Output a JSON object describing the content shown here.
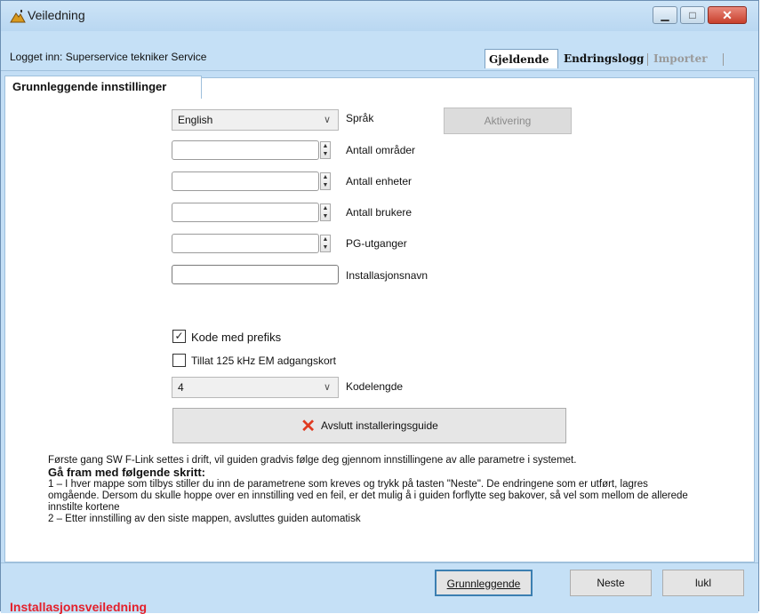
{
  "window": {
    "title": "Veiledning"
  },
  "header": {
    "logged_in": "Logget inn: Superservice tekniker Service",
    "tabs": [
      "Gjeldende",
      "Endringslogg",
      "Importer"
    ]
  },
  "subtab": "Grunnleggende innstillinger",
  "form": {
    "language": {
      "value": "English",
      "label": "Språk"
    },
    "activate_label": "Aktivering",
    "areas_label": "Antall områder",
    "units_label": "Antall enheter",
    "users_label": "Antall brukere",
    "pg_label": "PG-utganger",
    "install_name_label": "Installasjonsnavn",
    "prefix": {
      "label": "Kode med prefiks",
      "checked": true
    },
    "em_cards": {
      "label": "Tillat 125 kHz EM adgangskort",
      "checked": false
    },
    "code_length": {
      "value": "4",
      "label": "Kodelengde"
    },
    "exit_button": "Avslutt installeringsguide"
  },
  "description": {
    "intro": "Første gang SW F-Link settes i drift, vil guiden gradvis følge deg gjennom innstillingene av alle parametre i systemet.",
    "heading": "Gå fram med følgende skritt:",
    "step1": "1 – I hver mappe som tilbys stiller du inn de parametrene som kreves og trykk på tasten \"Neste\". De endringene som er utført, lagres omgående. Dersom du skulle hoppe over en innstilling ved en feil, er det mulig å i guiden forflytte seg bakover, så vel som mellom de allerede innstilte kortene",
    "step2": "2 – Etter innstilling av den siste mappen, avsluttes guiden automatisk"
  },
  "footer": {
    "title": "Installasjonsveiledning",
    "basic_button": "Grunnleggende",
    "next_button": "Neste",
    "close_button": "lukl"
  },
  "icons": {
    "dropdown": "chevron-down-icon",
    "exit": "close-x-icon",
    "checkbox": "check-icon"
  },
  "colors": {
    "panel": "#c5e0f6",
    "footer_title": "#e4202b",
    "exit_x": "#e03a20"
  }
}
